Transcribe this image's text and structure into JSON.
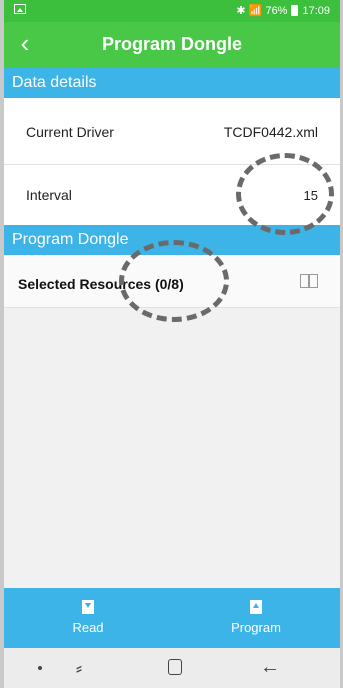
{
  "status_bar": {
    "left_icon": "gallery-icon",
    "right_text": "✱ 📶 76%",
    "time": "17:09"
  },
  "app_bar": {
    "back_icon": "chevron-left-icon",
    "title": "Program Dongle"
  },
  "data_details": {
    "header": "Data details",
    "rows": [
      {
        "label": "Current Driver",
        "value": "TCDF0442.xml"
      },
      {
        "label": "Interval",
        "value": "15"
      }
    ]
  },
  "program_dongle": {
    "header": "Program Dongle",
    "selected_resources_label": "Selected Resources (0/8)",
    "icon": "book-icon"
  },
  "bottom_bar": {
    "buttons": [
      {
        "label": "Read",
        "icon": "download-icon"
      },
      {
        "label": "Program",
        "icon": "upload-icon"
      }
    ]
  },
  "system_nav": {
    "items": [
      "dot",
      "recent-apps-icon",
      "home-icon",
      "back-icon"
    ]
  },
  "colors": {
    "status_green": "#3cbf3c",
    "appbar_green": "#48c846",
    "section_blue": "#3db4e7"
  }
}
